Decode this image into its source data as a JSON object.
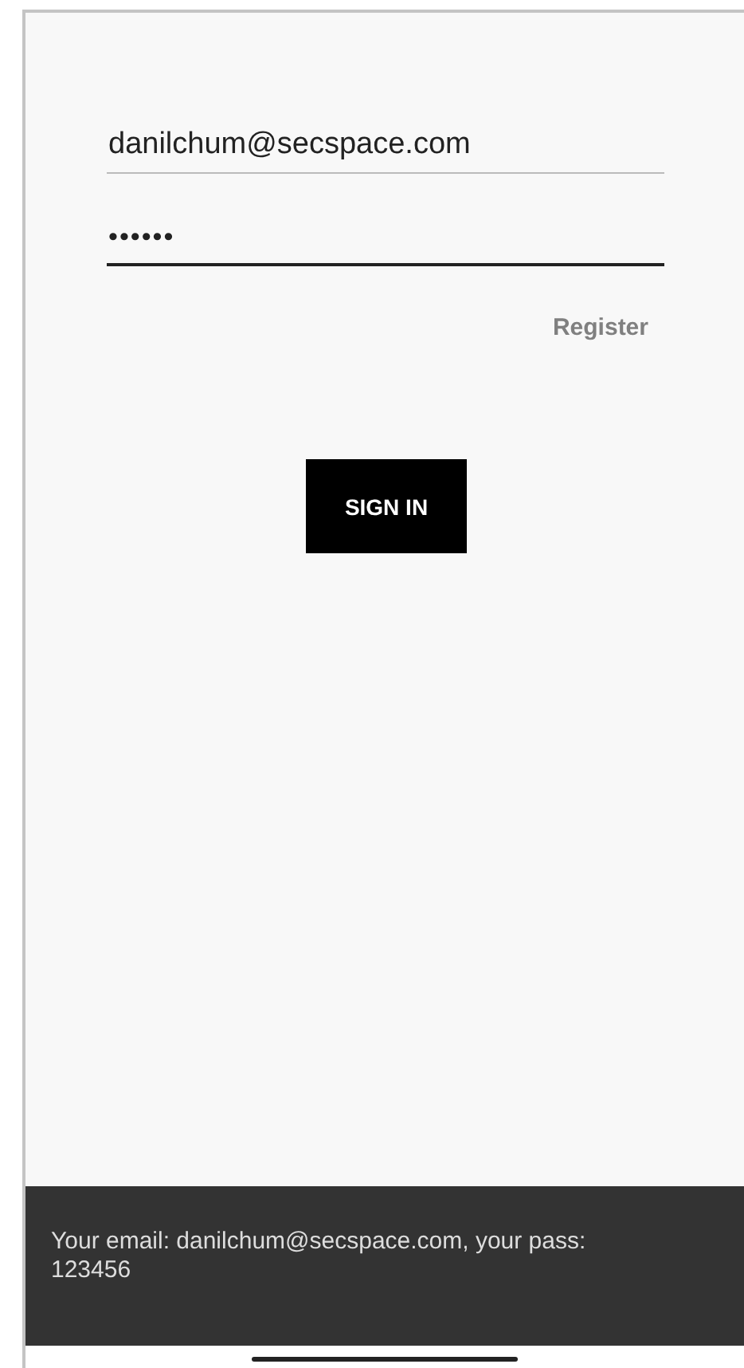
{
  "login_form": {
    "email": {
      "value": "danilchum@secspace.com",
      "focused": false
    },
    "password": {
      "value": "••••••",
      "focused": true
    },
    "register_link": "Register",
    "sign_in_button": "SIGN IN"
  },
  "snackbar": {
    "message": "Your email: danilchum@secspace.com, your pass: 123456"
  },
  "home_indicator": true
}
